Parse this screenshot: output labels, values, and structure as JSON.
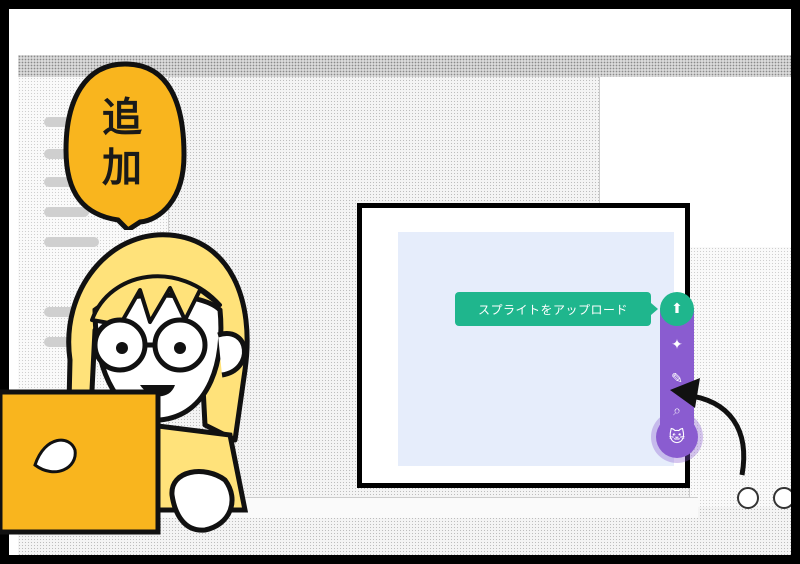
{
  "speech_bubble": {
    "line1": "追",
    "line2": "加",
    "color": "#F9B51E"
  },
  "inset": {
    "tooltip_text": "スプライトをアップロード",
    "tooltip_color": "#1FB68D",
    "menu_color": "#8A5CD0",
    "menu_items": [
      "upload-icon",
      "sparkle-icon",
      "brush-icon",
      "search-icon",
      "cat-icon"
    ]
  },
  "character": {
    "hair_color": "#FFE27A",
    "laptop_color": "#F9B51E",
    "shirt_color": "#FFE27A"
  }
}
